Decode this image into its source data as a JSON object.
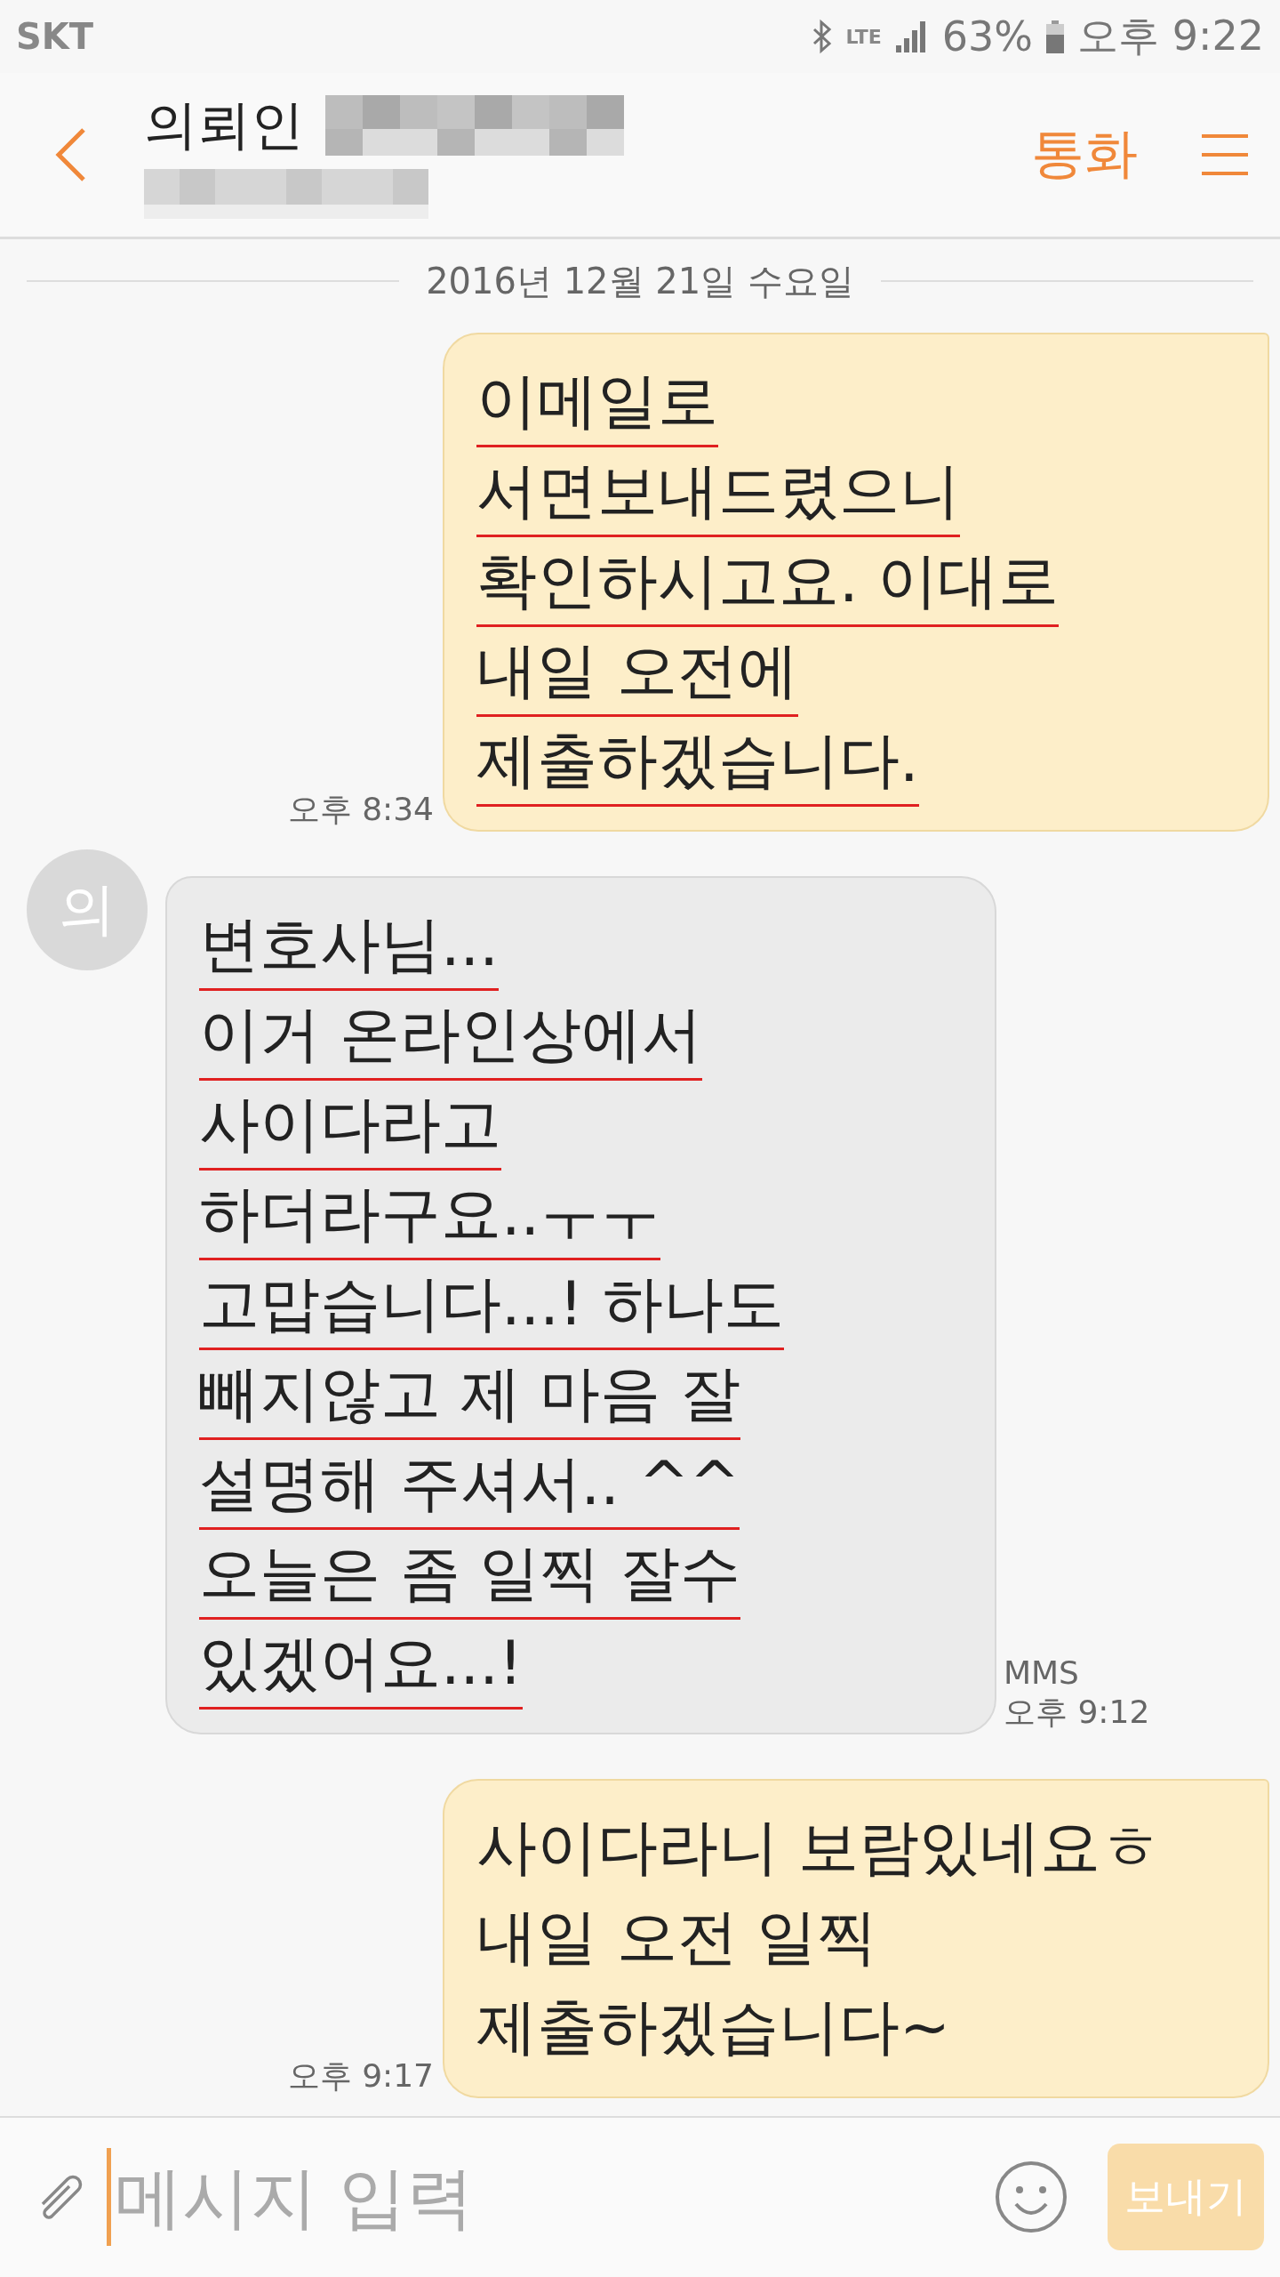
{
  "status_bar": {
    "carrier": "SKT",
    "network": "LTE",
    "battery": "63%",
    "time": "오후 9:22"
  },
  "header": {
    "title": "의뢰인",
    "call": "통화"
  },
  "date_divider": "2016년 12월 21일 수요일",
  "messages": [
    {
      "kind": "sent",
      "lines": [
        "이메일로",
        "서면보내드렸으니",
        "확인하시고요. 이대로",
        "내일 오전에",
        "제출하겠습니다."
      ],
      "underlined": true,
      "time": "오후 8:34"
    },
    {
      "kind": "received",
      "avatar": "의",
      "lines": [
        "변호사님...",
        "이거 온라인상에서",
        "사이다라고",
        "하더라구요..ㅜㅜ",
        "고맙습니다...! 하나도",
        "빼지않고 제 마음 잘",
        "설명해 주셔서.. ^^",
        "오늘은 좀 일찍 잘수",
        "있겠어요...!"
      ],
      "underlined": true,
      "type": "MMS",
      "time": "오후 9:12"
    },
    {
      "kind": "sent",
      "lines": [
        "사이다라니 보람있네요ㅎ",
        "내일 오전 일찍",
        "제출하겠습니다~"
      ],
      "underlined": false,
      "time": "오후 9:17"
    }
  ],
  "composer": {
    "placeholder": "메시지 입력",
    "send": "보내기",
    "send_disabled": true
  }
}
